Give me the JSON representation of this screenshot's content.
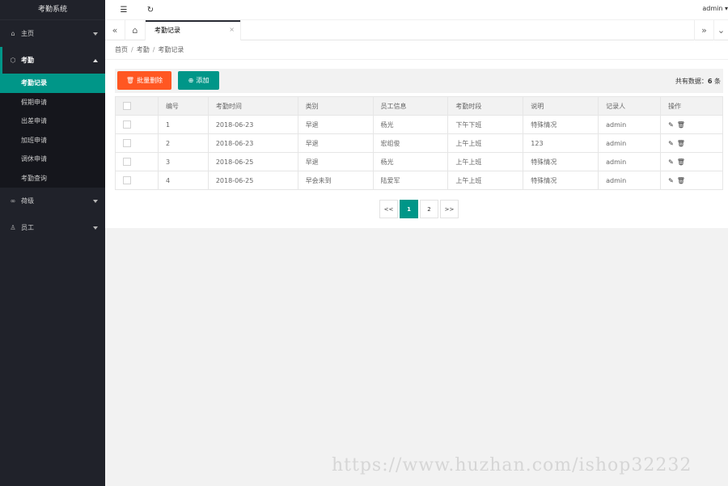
{
  "app": {
    "title": "考勤系统",
    "user": "admin ▾"
  },
  "sidebar": {
    "items": [
      {
        "label": "主页",
        "icon": "home-icon"
      },
      {
        "label": "考勤",
        "icon": "cube-icon",
        "open": true,
        "children": [
          "考勤记录",
          "假期申请",
          "出差申请",
          "加班申请",
          "调休申请",
          "考勤查询"
        ]
      },
      {
        "label": "荷级",
        "icon": "link-icon"
      },
      {
        "label": "员工",
        "icon": "user-icon"
      }
    ]
  },
  "header": {
    "menu_icon": "☰",
    "refresh_icon": "↻"
  },
  "tabs": {
    "current": "考勤记录",
    "close": "×"
  },
  "breadcrumb": [
    "首页",
    "考勤",
    "考勤记录"
  ],
  "toolbar": {
    "delete_label": "批量删除",
    "add_label": "添加",
    "total_label": "共有数据：",
    "total_count": "6",
    "total_unit": "条"
  },
  "table": {
    "headers": [
      "编号",
      "考勤时间",
      "类别",
      "员工信息",
      "考勤时段",
      "说明",
      "记录人",
      "操作"
    ],
    "rows": [
      [
        "1",
        "2018-06-23",
        "早退",
        "杨光",
        "下午下班",
        "特殊情况",
        "admin"
      ],
      [
        "2",
        "2018-06-23",
        "早退",
        "宏组俊",
        "上午上班",
        "123",
        "admin"
      ],
      [
        "3",
        "2018-06-25",
        "早退",
        "杨光",
        "上午上班",
        "特殊情况",
        "admin"
      ],
      [
        "4",
        "2018-06-25",
        "早会未到",
        "陆爱军",
        "上午上班",
        "特殊情况",
        "admin"
      ]
    ]
  },
  "pager": {
    "prev": "<<",
    "pages": [
      "1",
      "2"
    ],
    "next": ">>",
    "current": "1"
  },
  "watermark": "https://www.huzhan.com/ishop32232",
  "colors": {
    "sidebar_bg": "#20222a",
    "accent": "#009688",
    "danger": "#ff5722"
  }
}
